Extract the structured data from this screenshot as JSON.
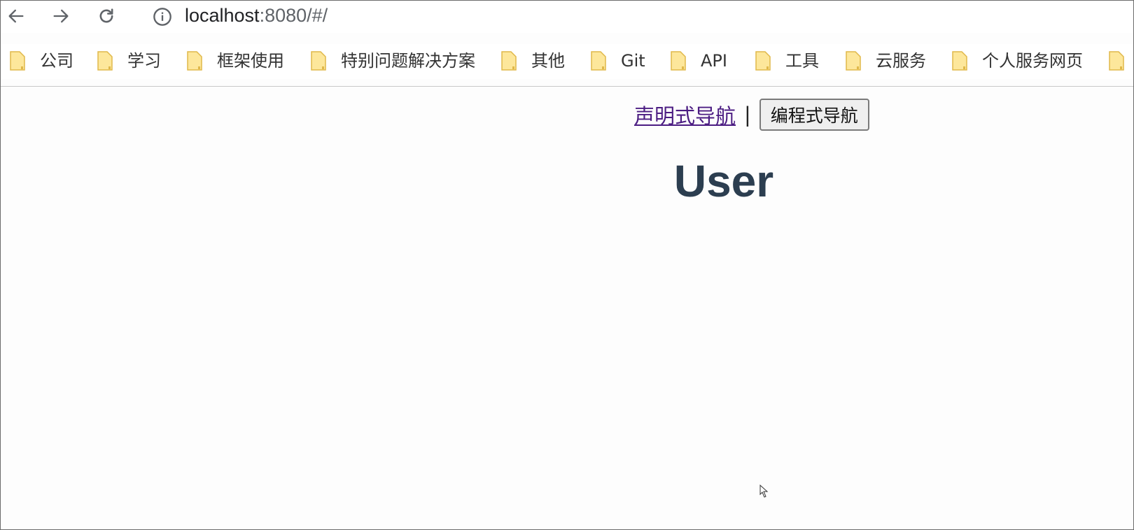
{
  "browser": {
    "url_host": "localhost",
    "url_rest": ":8080/#/",
    "icons": {
      "back": "arrow-left-icon",
      "forward": "arrow-right-icon",
      "reload": "reload-icon",
      "info": "info-icon"
    }
  },
  "bookmarks": [
    {
      "label": "公司"
    },
    {
      "label": "学习"
    },
    {
      "label": "框架使用"
    },
    {
      "label": "特别问题解决方案"
    },
    {
      "label": "其他"
    },
    {
      "label": "Git"
    },
    {
      "label": "API"
    },
    {
      "label": "工具"
    },
    {
      "label": "云服务"
    },
    {
      "label": "个人服务网页"
    },
    {
      "label": ""
    }
  ],
  "page": {
    "router_link_label": "声明式导航",
    "separator": "|",
    "programmatic_button_label": "编程式导航",
    "title": "User"
  },
  "colors": {
    "link_visited": "#4b1c82",
    "heading": "#2c3e50",
    "folder_fill": "#fde79b",
    "folder_stroke": "#e0b84a"
  }
}
